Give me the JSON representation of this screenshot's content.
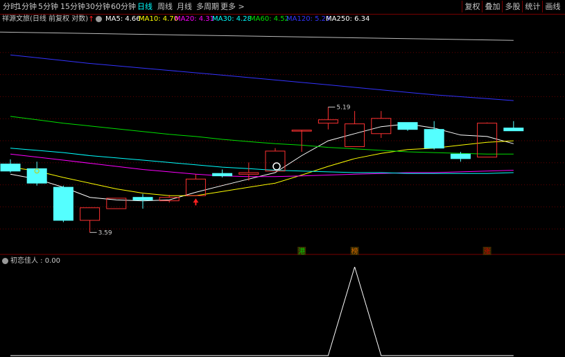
{
  "toolbar": {
    "period_tabs": [
      {
        "label": "分时",
        "active": false
      },
      {
        "label": "1分钟",
        "active": false
      },
      {
        "label": "5分钟",
        "active": false
      },
      {
        "label": "15分钟",
        "active": false
      },
      {
        "label": "30分钟",
        "active": false
      },
      {
        "label": "60分钟",
        "active": false
      },
      {
        "label": "日线",
        "active": true
      },
      {
        "label": "周线",
        "active": false
      },
      {
        "label": "月线",
        "active": false
      },
      {
        "label": "多周期",
        "active": false
      },
      {
        "label": "更多 >",
        "active": false
      }
    ],
    "right_buttons": [
      "复权",
      "叠加",
      "多股",
      "统计",
      "画线"
    ]
  },
  "indicator_bar": {
    "title": "祥源文旅(日线 前复权 对数)",
    "gear_icon": "gear-icon",
    "arrow_icon": "red-up-arrow-icon",
    "ma": [
      {
        "label": "MA5: 4.66",
        "color": "#ffffff"
      },
      {
        "label": "MA10: 4.70",
        "color": "#ffff00"
      },
      {
        "label": "MA20: 4.31",
        "color": "#ff00ff"
      },
      {
        "label": "MA30: 4.28",
        "color": "#00ffff"
      },
      {
        "label": "MA60: 4.52",
        "color": "#00e000"
      },
      {
        "label": "MA120: 5.29",
        "color": "#3333ff"
      },
      {
        "label": "MA250: 6.34",
        "color": "#ffffff"
      }
    ]
  },
  "chart_data": {
    "type": "candlestick",
    "scale": "log",
    "high_annotation": "5.19",
    "low_annotation": "3.59",
    "candles": [
      {
        "o": 4.39,
        "h": 4.45,
        "c": 4.3,
        "l": 4.28
      },
      {
        "o": 4.33,
        "h": 4.42,
        "c": 4.15,
        "l": 4.12
      },
      {
        "o": 4.1,
        "h": 4.12,
        "c": 3.72,
        "l": 3.7
      },
      {
        "o": 3.72,
        "h": 3.86,
        "c": 3.86,
        "l": 3.59
      },
      {
        "o": 3.85,
        "h": 3.97,
        "c": 3.97,
        "l": 3.85
      },
      {
        "o": 3.98,
        "h": 4.02,
        "c": 3.95,
        "l": 3.85
      },
      {
        "o": 3.94,
        "h": 4.01,
        "c": 3.98,
        "l": 3.92
      },
      {
        "o": 4.0,
        "h": 4.26,
        "c": 4.2,
        "l": 4.0
      },
      {
        "o": 4.27,
        "h": 4.32,
        "c": 4.24,
        "l": 4.22
      },
      {
        "o": 4.26,
        "h": 4.41,
        "c": 4.28,
        "l": 4.18
      },
      {
        "o": 4.3,
        "h": 4.6,
        "c": 4.56,
        "l": 4.3
      },
      {
        "o": 4.85,
        "h": 4.85,
        "c": 4.85,
        "l": 4.55
      },
      {
        "o": 4.95,
        "h": 5.19,
        "c": 5.0,
        "l": 4.86
      },
      {
        "o": 4.62,
        "h": 5.13,
        "c": 4.94,
        "l": 4.62
      },
      {
        "o": 4.8,
        "h": 5.13,
        "c": 5.02,
        "l": 4.74
      },
      {
        "o": 4.96,
        "h": 4.96,
        "c": 4.86,
        "l": 4.84
      },
      {
        "o": 4.86,
        "h": 4.98,
        "c": 4.6,
        "l": 4.58
      },
      {
        "o": 4.52,
        "h": 4.55,
        "c": 4.46,
        "l": 4.42
      },
      {
        "o": 4.48,
        "h": 4.96,
        "c": 4.95,
        "l": 4.48
      },
      {
        "o": 4.88,
        "h": 4.98,
        "c": 4.84,
        "l": 4.84
      }
    ],
    "ma_series": [
      {
        "name": "MA5",
        "color": "#ffffff",
        "values": [
          4.26,
          4.2,
          4.1,
          3.98,
          3.95,
          3.94,
          3.95,
          4.04,
          4.12,
          4.2,
          4.28,
          4.5,
          4.7,
          4.8,
          4.9,
          4.94,
          4.88,
          4.78,
          4.76,
          4.66
        ]
      },
      {
        "name": "MA10",
        "color": "#ffff00",
        "values": [
          4.35,
          4.3,
          4.22,
          4.15,
          4.08,
          4.03,
          4.0,
          4.0,
          4.05,
          4.1,
          4.15,
          4.25,
          4.36,
          4.46,
          4.53,
          4.58,
          4.6,
          4.64,
          4.68,
          4.7
        ]
      },
      {
        "name": "MA20",
        "color": "#ff00ff",
        "values": [
          4.52,
          4.48,
          4.44,
          4.4,
          4.36,
          4.32,
          4.29,
          4.26,
          4.24,
          4.23,
          4.23,
          4.24,
          4.25,
          4.26,
          4.27,
          4.28,
          4.28,
          4.29,
          4.3,
          4.31
        ]
      },
      {
        "name": "MA30",
        "color": "#00ffff",
        "values": [
          4.6,
          4.57,
          4.54,
          4.5,
          4.47,
          4.44,
          4.41,
          4.38,
          4.35,
          4.33,
          4.31,
          4.3,
          4.29,
          4.28,
          4.28,
          4.27,
          4.27,
          4.27,
          4.27,
          4.28
        ]
      },
      {
        "name": "MA60",
        "color": "#00e000",
        "values": [
          5.05,
          5.0,
          4.95,
          4.91,
          4.87,
          4.83,
          4.79,
          4.76,
          4.72,
          4.69,
          4.66,
          4.64,
          4.61,
          4.59,
          4.57,
          4.55,
          4.54,
          4.53,
          4.52,
          4.52
        ]
      },
      {
        "name": "MA120",
        "color": "#3333ff",
        "values": [
          6.05,
          6.0,
          5.95,
          5.9,
          5.86,
          5.82,
          5.78,
          5.74,
          5.7,
          5.66,
          5.62,
          5.58,
          5.54,
          5.5,
          5.46,
          5.42,
          5.38,
          5.35,
          5.32,
          5.29
        ]
      }
    ],
    "ma250_top": 6.34,
    "markers": {
      "badges": [
        {
          "index": 11,
          "label": "港",
          "color": "#00cc00"
        },
        {
          "index": 13,
          "label": "榜",
          "color": "#cc6600"
        },
        {
          "index": 18,
          "label": "涨",
          "color": "#cc0000"
        }
      ]
    },
    "sub_indicator": {
      "name": "初恋佳人",
      "value_label": "初恋佳人 : 0.00",
      "values": [
        0,
        0,
        0,
        0,
        0,
        0,
        0,
        0,
        0,
        0,
        0,
        0,
        0,
        1,
        0,
        0,
        0,
        0,
        0,
        0
      ]
    }
  }
}
